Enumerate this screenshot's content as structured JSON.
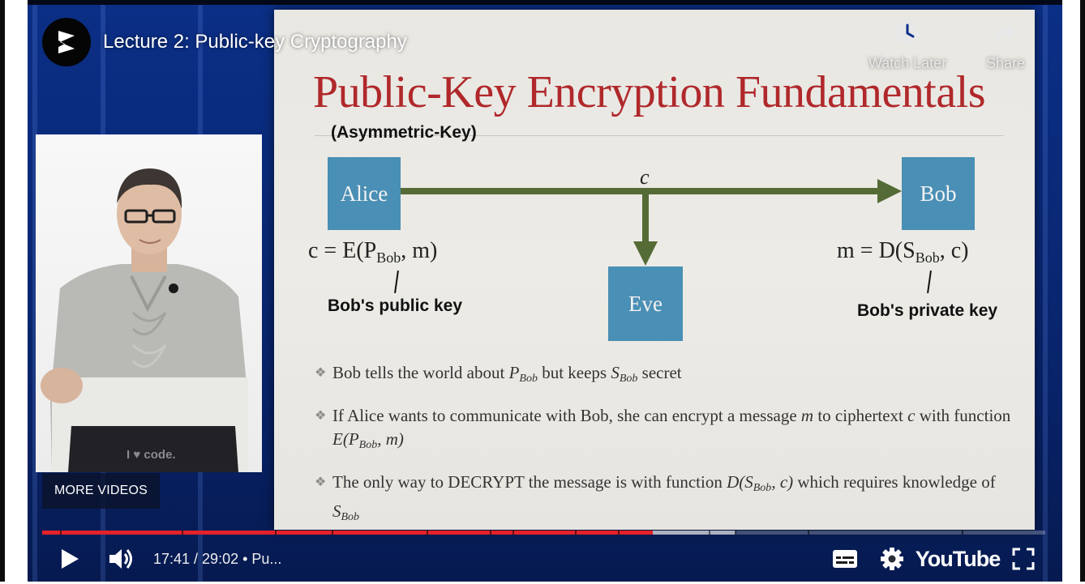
{
  "player": {
    "video_title": "Lecture 2: Public-key Cryptography",
    "watch_later_label": "Watch Later",
    "share_label": "Share",
    "more_videos_label": "MORE VIDEOS",
    "time_current": "17:41",
    "time_total": "29:02",
    "time_display": "17:41 / 29:02 • Pu...",
    "progress_played_fraction": 0.609,
    "progress_loaded_fraction": 0.691,
    "youtube_label": "YouTube",
    "laptop_sticker": "I ♥ code.",
    "colors": {
      "accent_progress": "#e32229",
      "slide_title": "#b0282b",
      "node_box": "#4a8fb5",
      "arrow": "#556b35"
    },
    "icons": [
      "channel-logo-icon",
      "clock-icon",
      "share-arrow-icon",
      "play-icon",
      "volume-icon",
      "subtitles-icon",
      "settings-gear-icon",
      "fullscreen-icon"
    ]
  },
  "slide": {
    "title": "Public-Key Encryption Fundamentals",
    "subtitle": "(Asymmetric-Key)",
    "nodes": {
      "alice": "Alice",
      "bob": "Bob",
      "eve": "Eve"
    },
    "channel_label": "c",
    "formula_left": {
      "prefix": "c = E(P",
      "sub": "Bob",
      "suffix": ", m)"
    },
    "formula_right": {
      "prefix": "m = D(S",
      "sub": "Bob",
      "suffix": ", c)"
    },
    "public_key_label": "Bob's public key",
    "private_key_label": "Bob's private key",
    "bullet_marker": "❖",
    "bullets": {
      "b1": {
        "t1": "Bob tells the world about ",
        "p": "P",
        "s1": "Bob",
        "t2": " but keeps ",
        "s": "S",
        "s2": "Bob",
        "t3": " secret"
      },
      "b2": {
        "t1": "If Alice wants to communicate with Bob, she can encrypt a message ",
        "m": "m",
        "t2": " to ciphertext ",
        "c": "c",
        "t3": " with function ",
        "fn_prefix": "E(P",
        "sub": "Bob",
        "fn_suffix": ", m)"
      },
      "b3": {
        "t1": "The only way to DECRYPT the message is with function ",
        "fn_prefix": "D(S",
        "sub": "Bob",
        "fn_suffix": ", c)",
        "t2": " which requires knowledge of ",
        "s": "S",
        "s_sub": "Bob"
      }
    }
  }
}
